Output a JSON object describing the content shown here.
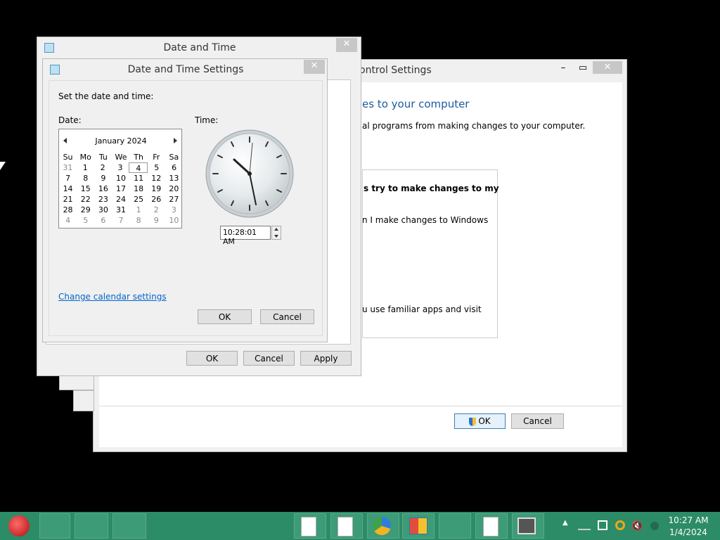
{
  "back_window": {
    "title_partial": "ontrol Settings",
    "heading": "es to your computer",
    "desc": "al programs from making changes to your computer.",
    "option1": "s try to make changes to my",
    "option2": "n I make changes to Windows",
    "option3": "u use familiar apps and visit",
    "ok": "OK",
    "cancel": "Cancel"
  },
  "date_time": {
    "title": "Date and Time",
    "ok": "OK",
    "cancel": "Cancel",
    "apply": "Apply"
  },
  "settings": {
    "title": "Date and Time Settings",
    "instruction": "Set the date and time:",
    "date_label": "Date:",
    "time_label": "Time:",
    "month": "January 2024",
    "weekdays": [
      "Su",
      "Mo",
      "Tu",
      "We",
      "Th",
      "Fr",
      "Sa"
    ],
    "weeks": [
      [
        "31",
        "1",
        "2",
        "3",
        "4",
        "5",
        "6"
      ],
      [
        "7",
        "8",
        "9",
        "10",
        "11",
        "12",
        "13"
      ],
      [
        "14",
        "15",
        "16",
        "17",
        "18",
        "19",
        "20"
      ],
      [
        "21",
        "22",
        "23",
        "24",
        "25",
        "26",
        "27"
      ],
      [
        "28",
        "29",
        "30",
        "31",
        "1",
        "2",
        "3"
      ],
      [
        "4",
        "5",
        "6",
        "7",
        "8",
        "9",
        "10"
      ]
    ],
    "time_value": "10:28:01 AM",
    "calendar_link": "Change calendar settings",
    "ok": "OK",
    "cancel": "Cancel"
  },
  "taskbar": {
    "time": "10:27 AM",
    "date": "1/4/2024"
  }
}
